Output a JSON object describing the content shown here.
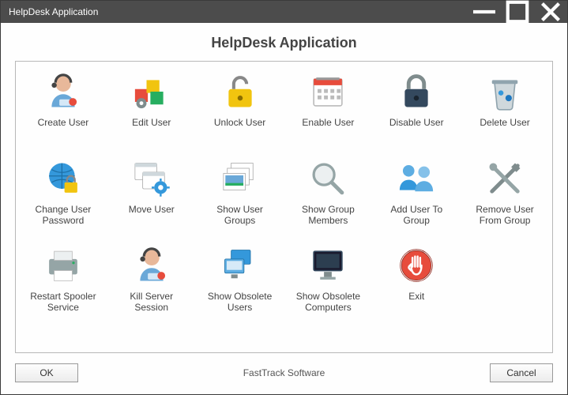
{
  "window": {
    "title": "HelpDesk Application",
    "heading": "HelpDesk Application",
    "brand": "FastTrack Software",
    "ok_label": "OK",
    "cancel_label": "Cancel"
  },
  "items": [
    {
      "label": "Create User",
      "icon": "user-headset-icon"
    },
    {
      "label": "Edit User",
      "icon": "blocks-gear-icon"
    },
    {
      "label": "Unlock User",
      "icon": "padlock-open-icon"
    },
    {
      "label": "Enable User",
      "icon": "calendar-icon"
    },
    {
      "label": "Disable User",
      "icon": "padlock-closed-icon"
    },
    {
      "label": "Delete User",
      "icon": "trash-icon"
    },
    {
      "label": "Change User Password",
      "icon": "globe-lock-icon"
    },
    {
      "label": "Move User",
      "icon": "windows-gear-icon"
    },
    {
      "label": "Show User Groups",
      "icon": "photo-stack-icon"
    },
    {
      "label": "Show Group Members",
      "icon": "magnifier-icon"
    },
    {
      "label": "Add User To Group",
      "icon": "users-group-icon"
    },
    {
      "label": "Remove User From Group",
      "icon": "tools-cross-icon"
    },
    {
      "label": "Restart Spooler Service",
      "icon": "printer-icon"
    },
    {
      "label": "Kill Server Session",
      "icon": "user-headset-icon"
    },
    {
      "label": "Show Obsolete Users",
      "icon": "computers-stack-icon"
    },
    {
      "label": "Show Obsolete Computers",
      "icon": "monitor-icon"
    },
    {
      "label": "Exit",
      "icon": "stop-hand-icon"
    }
  ],
  "icons": {
    "user-headset-icon": "👩‍💼",
    "blocks-gear-icon": "🧩",
    "padlock-open-icon": "🔓",
    "calendar-icon": "📅",
    "padlock-closed-icon": "🔒",
    "trash-icon": "🗑️",
    "globe-lock-icon": "🌐",
    "windows-gear-icon": "⚙️",
    "photo-stack-icon": "🖼️",
    "magnifier-icon": "🔍",
    "users-group-icon": "👥",
    "tools-cross-icon": "🛠️",
    "printer-icon": "🖨️",
    "computers-stack-icon": "🖥️",
    "monitor-icon": "💻",
    "stop-hand-icon": "✋"
  }
}
